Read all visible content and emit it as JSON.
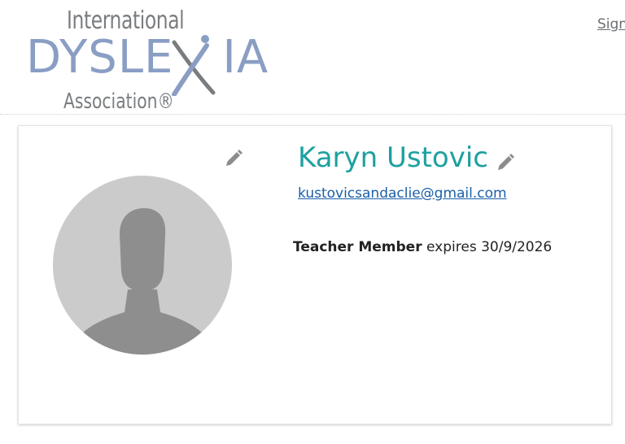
{
  "header": {
    "logo": {
      "line1": "International",
      "line2_part1": "DYSLE",
      "line2_part2": "IA",
      "line3": "Association®"
    },
    "signin_label": "Sign"
  },
  "profile": {
    "name": "Karyn Ustovic",
    "email": "kustovicsandaclie@gmail.com",
    "membership_type": "Teacher Member",
    "membership_expiry": "expires 30/9/2026",
    "icons": {
      "avatar": "default-avatar-silhouette",
      "edit_photo": "pencil-icon",
      "edit_name": "pencil-icon"
    }
  },
  "colors": {
    "name": "#1ea0a0",
    "link": "#1a5fa8",
    "logo_blue": "#8a9ec4",
    "logo_gray": "#7a7d80",
    "avatar_bg": "#cbcbcb",
    "avatar_figure": "#8e8e8e"
  }
}
